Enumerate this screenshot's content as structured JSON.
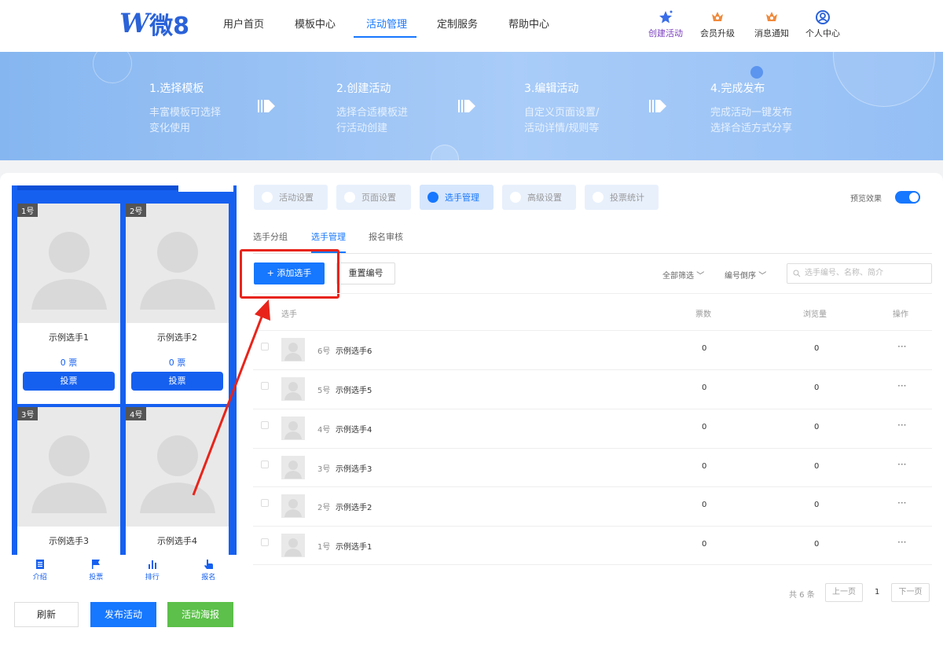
{
  "header": {
    "logo_text": "微8",
    "nav": [
      "用户首页",
      "模板中心",
      "活动管理",
      "定制服务",
      "帮助中心"
    ],
    "active_nav": "活动管理",
    "icons": [
      {
        "label": "创建活动",
        "icon": "star-icon"
      },
      {
        "label": "会员升级",
        "icon": "crown-icon"
      },
      {
        "label": "消息通知",
        "icon": "bell-icon"
      },
      {
        "label": "个人中心",
        "icon": "user-icon"
      }
    ]
  },
  "banner": {
    "steps": [
      {
        "title": "1.选择模板",
        "desc1": "丰富模板可选择",
        "desc2": "变化使用"
      },
      {
        "title": "2.创建活动",
        "desc1": "选择合适模板进",
        "desc2": "行活动创建"
      },
      {
        "title": "3.编辑活动",
        "desc1": "自定义页面设置/",
        "desc2": "活动详情/规则等"
      },
      {
        "title": "4.完成发布",
        "desc1": "完成活动一键发布",
        "desc2": "选择合适方式分享"
      }
    ]
  },
  "preview": {
    "contestants": [
      {
        "num": "1号",
        "name": "示例选手1",
        "votes": "0 票",
        "vote_btn": "投票"
      },
      {
        "num": "2号",
        "name": "示例选手2",
        "votes": "0 票",
        "vote_btn": "投票"
      },
      {
        "num": "3号",
        "name": "示例选手3"
      },
      {
        "num": "4号",
        "name": "示例选手4"
      }
    ],
    "bottom_nav": [
      "介绍",
      "投票",
      "排行",
      "报名"
    ],
    "buttons": {
      "refresh": "刷新",
      "publish": "发布活动",
      "poster": "活动海报"
    }
  },
  "tabs": [
    {
      "label": "活动设置",
      "icon": "heart-icon"
    },
    {
      "label": "页面设置",
      "icon": "layout-icon"
    },
    {
      "label": "选手管理",
      "icon": "contestant-icon"
    },
    {
      "label": "高级设置",
      "icon": "advanced-icon"
    },
    {
      "label": "投票统计",
      "icon": "stats-icon"
    }
  ],
  "active_tab": "选手管理",
  "preview_toggle": {
    "label": "预览效果",
    "on": true
  },
  "subtabs": [
    "选手分组",
    "选手管理",
    "报名审核"
  ],
  "active_subtab": "选手管理",
  "toolbar": {
    "add": "+ 添加选手",
    "renumber": "重置编号",
    "filter_all": "全部筛选",
    "sort": "编号倒序",
    "search_placeholder": "选手编号、名称、简介"
  },
  "table": {
    "headers": {
      "contestant": "选手",
      "votes": "票数",
      "views": "浏览量",
      "actions": "操作"
    },
    "rows": [
      {
        "num": "6号",
        "name": "示例选手6",
        "votes": "0",
        "views": "0",
        "more": "···"
      },
      {
        "num": "5号",
        "name": "示例选手5",
        "votes": "0",
        "views": "0",
        "more": "···"
      },
      {
        "num": "4号",
        "name": "示例选手4",
        "votes": "0",
        "views": "0",
        "more": "···"
      },
      {
        "num": "3号",
        "name": "示例选手3",
        "votes": "0",
        "views": "0",
        "more": "···"
      },
      {
        "num": "2号",
        "name": "示例选手2",
        "votes": "0",
        "views": "0",
        "more": "···"
      },
      {
        "num": "1号",
        "name": "示例选手1",
        "votes": "0",
        "views": "0",
        "more": "···"
      }
    ]
  },
  "pagination": {
    "total": "共 6 条",
    "prev": "上一页",
    "current": "1",
    "next": "下一页"
  },
  "colors": {
    "primary": "#1677ff",
    "phone_blue": "#1660f0",
    "green": "#5cc04a",
    "highlight_red": "#e8241a"
  }
}
